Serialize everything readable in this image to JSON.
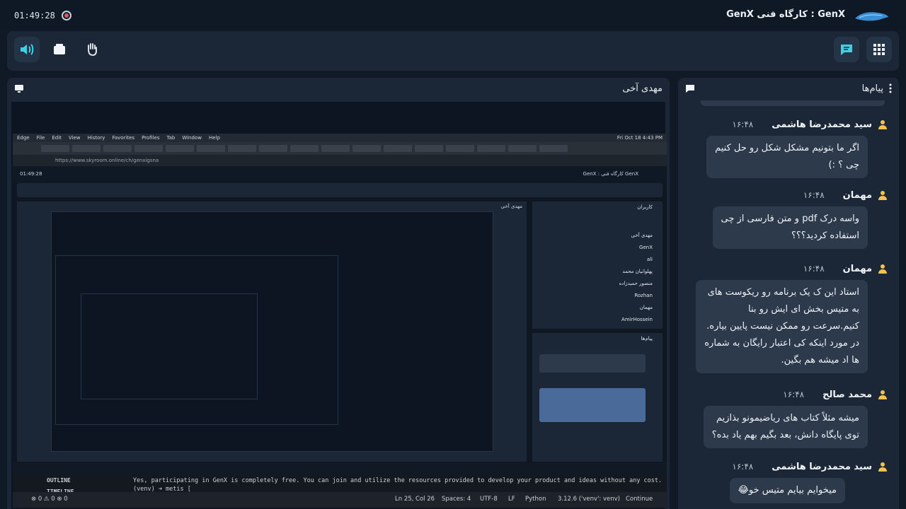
{
  "topbar": {
    "timer": "01:49:28",
    "title": "GenX : کارگاه فنی GenX"
  },
  "toolbar": {
    "left_icons": [
      "speaker-icon",
      "folder-icon",
      "hand-icon"
    ],
    "right_icons": [
      "chat-icon",
      "grid-icon"
    ]
  },
  "video_panel": {
    "presenter": "مهدی آخی",
    "screen": {
      "mac_menu": [
        "Edge",
        "File",
        "Edit",
        "View",
        "History",
        "Favorites",
        "Profiles",
        "Tab",
        "Window",
        "Help"
      ],
      "clock": "Fri Oct 18  4:43 PM",
      "url": "https://www.skyroom.online/ch/genxigsna",
      "inner_timer": "01:49:28",
      "inner_title": "GenX : کارگاه فنی GenX",
      "inner_presenter": "مهدی آخی",
      "users_title": "کاربران",
      "users": [
        "مهدی آخی",
        "GenX",
        "ali",
        "پهلوانیان محمد",
        "منصور حمیدزاده",
        "Rozhan",
        "مهمان",
        "AmirHossein"
      ],
      "messages_title": "پیام‌ها",
      "terminal_line": "Yes, participating in GenX is completely free. You can join and utilize the resources provided to develop your product and ideas without any cost.",
      "prompt": "(venv) ➜  metis [",
      "outline": "OUTLINE",
      "timeline": "TIMELINE",
      "status_left": "⊗ 0 ⚠ 0   ⊗ 0",
      "status_pos": "Ln 25, Col 26",
      "status_spaces": "Spaces: 4",
      "status_enc": "UTF-8",
      "status_eol": "LF",
      "status_lang": "Python",
      "status_env": "3.12.6 ('venv': venv)",
      "status_continue": "Continue"
    }
  },
  "chat_panel": {
    "title": "پیام‌ها",
    "messages": [
      {
        "sender": "سید محمدرضا هاشمی",
        "time": "۱۶:۴۸",
        "lines": [
          "اگر ما بتونیم مشکل شکل رو حل کنیم",
          "چی ؟ :)"
        ]
      },
      {
        "sender": "مهمان",
        "time": "۱۶:۴۸",
        "lines": [
          "واسه درک pdf و متن فارسی از چی",
          "استفاده کردید؟؟؟"
        ]
      },
      {
        "sender": "مهمان",
        "time": "۱۶:۴۸",
        "lines": [
          "استاد این ک یک برنامه رو ریکوست های",
          "به متیس بخش ای ایش رو بنا",
          "کنیم.سرعت رو ممکن نیست پایین بیاره.",
          "در مورد اینکه کی اعتبار رایگان به شماره",
          "ها اد میشه هم بگین."
        ]
      },
      {
        "sender": "محمد صالح",
        "time": "۱۶:۴۸",
        "lines": [
          "میشه مثلاً کتاب های ریاضیمونو بذازیم",
          "توی پایگاه دانش، بعد بگیم بهم یاد بده؟"
        ]
      },
      {
        "sender": "سید محمدرضا هاشمی",
        "time": "۱۶:۴۸",
        "lines": [
          "میخوایم بیایم متیس خو😂"
        ]
      }
    ]
  },
  "colors": {
    "accent": "#3fd0e8",
    "user_icon": "#f2c14e"
  }
}
